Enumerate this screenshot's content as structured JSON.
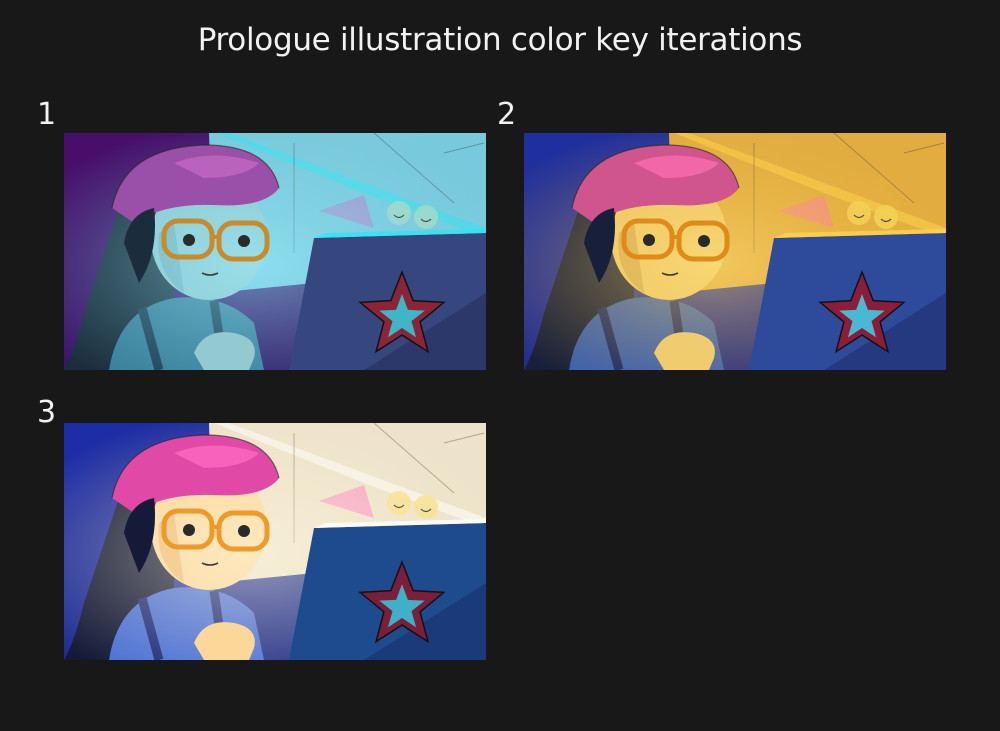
{
  "title": "Prologue illustration color key iterations",
  "panels": [
    {
      "number": "1",
      "palette": {
        "bg": "#4a0d6a",
        "bg2": "#2a1f6a",
        "wall": "#7fd9e6",
        "wall_edge": "#2fe3f2",
        "hat": "#9a4fa8",
        "hat_hi": "#c86cc4",
        "hair": "#1b2d3c",
        "skin": "#93c9d0",
        "skin_shade": "#6aa7b3",
        "glasses": "#c98a2a",
        "shirt": "#3a7e9a",
        "strap": "#1e3e55",
        "laptop": "#36467e",
        "laptop_dark": "#262e5c",
        "star_outer": "#8a2538",
        "star_inner": "#3fb6c6",
        "doll": "#a6d9c4",
        "glow": "#9ff3ff"
      }
    },
    {
      "number": "2",
      "palette": {
        "bg": "#1f2fa0",
        "bg2": "#2a2f7a",
        "wall": "#f2b73a",
        "wall_edge": "#ffd54a",
        "hat": "#d0558e",
        "hat_hi": "#ff6fb3",
        "hair": "#171f3a",
        "skin": "#f0cc6e",
        "skin_shade": "#c79a4a",
        "glasses": "#e08a1a",
        "shirt": "#3a5fae",
        "strap": "#1c2a66",
        "laptop": "#2e4a9a",
        "laptop_dark": "#1e2e6e",
        "star_outer": "#8a1e3a",
        "star_inner": "#4ab8d0",
        "doll": "#f3d45a",
        "glow": "#ffe27a"
      }
    },
    {
      "number": "3",
      "palette": {
        "bg": "#1d2da8",
        "bg2": "#23307e",
        "wall": "#fff3cf",
        "wall_edge": "#ffffff",
        "hat": "#e04aa6",
        "hat_hi": "#ff6cc6",
        "hair": "#141a38",
        "skin": "#fbd79a",
        "skin_shade": "#e6a85a",
        "glasses": "#ee9a2a",
        "shirt": "#4a6fd6",
        "strap": "#1c2a7a",
        "laptop": "#1e4a8e",
        "laptop_dark": "#17306a",
        "star_outer": "#7a1e3a",
        "star_inner": "#3fb0c6",
        "doll": "#f6e08a",
        "glow": "#fff8e2"
      }
    }
  ]
}
